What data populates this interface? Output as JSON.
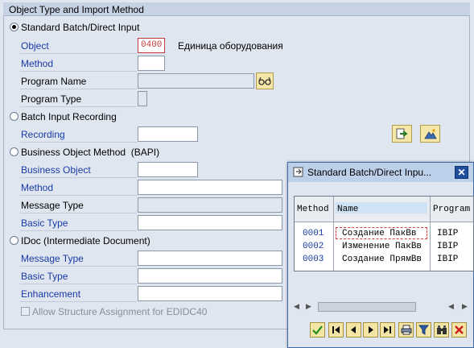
{
  "group": {
    "title": "Object Type and Import Method"
  },
  "standard": {
    "option_label": "Standard Batch/Direct Input",
    "object_label": "Object",
    "object_value": "0400",
    "object_description": "Единица оборудования",
    "method_label": "Method",
    "method_value": "",
    "program_name_label": "Program Name",
    "program_type_label": "Program Type"
  },
  "batch": {
    "option_label": "Batch Input Recording",
    "recording_label": "Recording"
  },
  "bapi": {
    "option_label": "Business Object Method  (BAPI)",
    "business_object_label": "Business Object",
    "method_label": "Method",
    "message_type_label": "Message Type",
    "basic_type_label": "Basic Type"
  },
  "idoc": {
    "option_label": "IDoc (Intermediate Document)",
    "message_type_label": "Message Type",
    "basic_type_label": "Basic Type",
    "enhancement_label": "Enhancement",
    "allow_assignment_label": "Allow Structure Assignment for EDIDC40"
  },
  "popup": {
    "title": "Standard Batch/Direct Inpu...",
    "columns": [
      "Method",
      "Name",
      "Program"
    ],
    "rows": [
      {
        "method": "0001",
        "name": "Создание ПакВв",
        "program": "IBIP"
      },
      {
        "method": "0002",
        "name": "Изменение ПакВв",
        "program": "IBIP"
      },
      {
        "method": "0003",
        "name": "Создание ПрямВв",
        "program": "IBIP"
      }
    ]
  },
  "icons": [
    "radio-button-icon",
    "glasses-icon",
    "arrow-right-icon",
    "mountain-icon",
    "checkmark-icon",
    "first-page-icon",
    "previous-page-icon",
    "next-page-icon",
    "last-page-icon",
    "print-icon",
    "filter-icon",
    "binoculars-icon",
    "cancel-icon",
    "close-icon"
  ],
  "colors": {
    "label_blue": "#1a3aa6",
    "required_red": "#c23a3a",
    "background": "#dfe6f0",
    "header": "#c7d3e4"
  }
}
